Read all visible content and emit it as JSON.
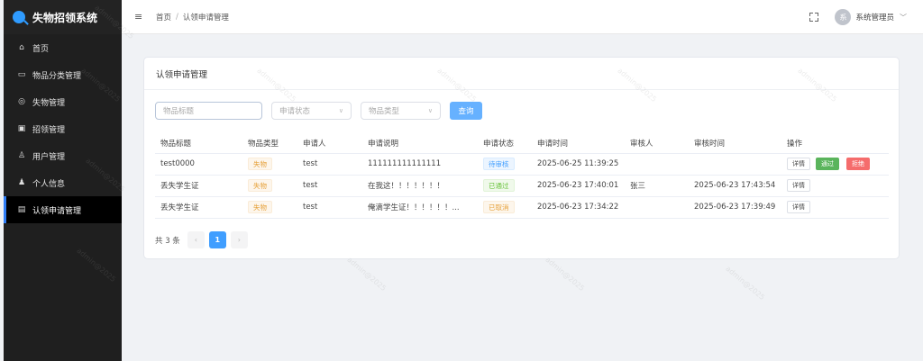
{
  "app": {
    "title": "失物招领系统"
  },
  "sidebar": {
    "items": [
      {
        "label": "首页",
        "icon": "home-icon"
      },
      {
        "label": "物品分类管理",
        "icon": "folder-icon"
      },
      {
        "label": "失物管理",
        "icon": "lost-item-icon"
      },
      {
        "label": "招领管理",
        "icon": "notebook-icon"
      },
      {
        "label": "用户管理",
        "icon": "user-outline-icon"
      },
      {
        "label": "个人信息",
        "icon": "user-solid-icon"
      },
      {
        "label": "认领申请管理",
        "icon": "document-icon",
        "active": true
      }
    ]
  },
  "header": {
    "breadcrumb": [
      "首页",
      "认领申请管理"
    ],
    "separator": "/",
    "avatar_text": "系",
    "user_name": "系统管理员"
  },
  "card": {
    "title": "认领申请管理"
  },
  "filters": {
    "title_placeholder": "物品标题",
    "status_placeholder": "申请状态",
    "type_placeholder": "物品类型",
    "query_label": "查询"
  },
  "table": {
    "columns": [
      "物品标题",
      "物品类型",
      "申请人",
      "申请说明",
      "申请状态",
      "申请时间",
      "审核人",
      "审核时间",
      "操作"
    ],
    "rows": [
      {
        "title": "test0000",
        "type": "失物",
        "applicant": "test",
        "desc": "111111111111111",
        "status": "待审核",
        "status_color": "blue",
        "apply_time": "2025-06-25 11:39:25",
        "reviewer": "",
        "review_time": "",
        "actions": [
          "详情",
          "通过",
          "拒绝"
        ]
      },
      {
        "title": "丢失学生证",
        "type": "失物",
        "applicant": "test",
        "desc": "在我这！！！！！！！",
        "status": "已通过",
        "status_color": "green",
        "apply_time": "2025-06-23 17:40:01",
        "reviewer": "张三",
        "review_time": "2025-06-23 17:43:54",
        "actions": [
          "详情"
        ]
      },
      {
        "title": "丢失学生证",
        "type": "失物",
        "applicant": "test",
        "desc": "俺滴学生证！！！！！！...",
        "status": "已取消",
        "status_color": "orange",
        "apply_time": "2025-06-23 17:34:22",
        "reviewer": "",
        "review_time": "2025-06-23 17:39:49",
        "actions": [
          "详情"
        ]
      }
    ]
  },
  "pagination": {
    "total_text": "共 3 条",
    "prev": "‹",
    "current": "1",
    "next": "›"
  },
  "watermark": "admin@2025"
}
